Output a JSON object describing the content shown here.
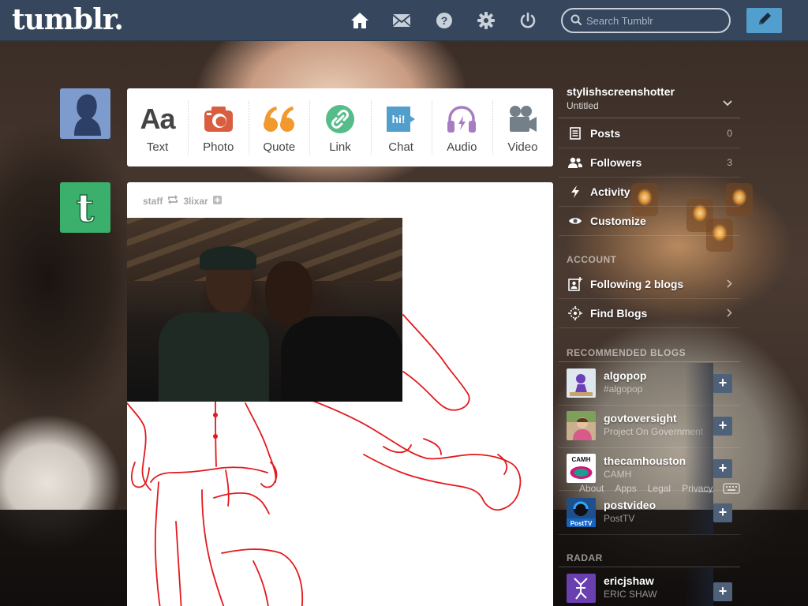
{
  "header": {
    "logo": "tumblr.",
    "search_placeholder": "Search Tumblr",
    "nav_icons": [
      "home-icon",
      "mail-icon",
      "help-icon",
      "gear-icon",
      "power-icon"
    ],
    "compose_icon": "pencil-icon",
    "colors": {
      "bar": "#36465d",
      "compose": "#529ecc"
    }
  },
  "post_types": [
    {
      "label": "Text",
      "icon": "text-icon",
      "color": "#444444"
    },
    {
      "label": "Photo",
      "icon": "camera-icon",
      "color": "#d95e40"
    },
    {
      "label": "Quote",
      "icon": "quote-icon",
      "color": "#f2992e"
    },
    {
      "label": "Link",
      "icon": "link-icon",
      "color": "#56bc8a"
    },
    {
      "label": "Chat",
      "icon": "chat-icon",
      "color": "#529ecc"
    },
    {
      "label": "Audio",
      "icon": "headphones-icon",
      "color": "#a77dc2"
    },
    {
      "label": "Video",
      "icon": "video-camera-icon",
      "color": "#748089"
    }
  ],
  "post": {
    "author": "staff",
    "reblog_icon": "reblog-icon",
    "reblogged_from": "3lixar",
    "follow_icon": "plus-icon"
  },
  "sidebar": {
    "blog_name": "stylishscreenshotter",
    "blog_title": "Untitled",
    "items": [
      {
        "label": "Posts",
        "count": "0",
        "icon": "posts-icon"
      },
      {
        "label": "Followers",
        "count": "3",
        "icon": "followers-icon"
      },
      {
        "label": "Activity",
        "count": "",
        "icon": "lightning-icon"
      },
      {
        "label": "Customize",
        "count": "",
        "icon": "eye-icon"
      }
    ],
    "account_heading": "ACCOUNT",
    "account_items": [
      {
        "label": "Following 2 blogs",
        "icon": "following-icon"
      },
      {
        "label": "Find Blogs",
        "icon": "compass-icon"
      }
    ],
    "recommended_heading": "RECOMMENDED BLOGS",
    "recommended": [
      {
        "name": "algopop",
        "sub": "#algopop",
        "thumb_color": "#dfe7ee"
      },
      {
        "name": "govtoversight",
        "sub": "Project On Government",
        "thumb_color": "#c9b08e"
      },
      {
        "name": "thecamhouston",
        "sub": "CAMH",
        "thumb_color": "#ffffff",
        "thumb_text": "CAMH"
      },
      {
        "name": "postvideo",
        "sub": "PostTV",
        "thumb_color": "#1f4f8a",
        "thumb_text": "PostTV"
      }
    ],
    "footer_links": [
      "About",
      "Apps",
      "Legal",
      "Privacy"
    ],
    "keyboard_icon": "keyboard-icon",
    "radar_heading": "RADAR",
    "radar": {
      "name": "ericjshaw",
      "sub": "ERIC SHAW",
      "thumb_color": "#6a3fb0"
    }
  }
}
